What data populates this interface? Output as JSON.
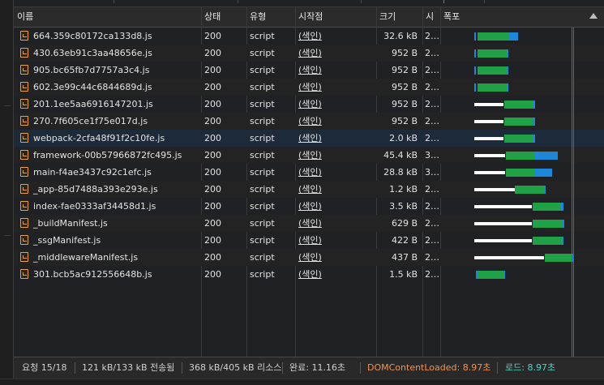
{
  "header": {
    "name": "이름",
    "status": "상태",
    "type": "유형",
    "initiator": "시작점",
    "size": "크기",
    "time": "시",
    "waterfall": "폭포"
  },
  "rows": [
    {
      "name": "664.359c80172ca133d8.js",
      "status": "200",
      "type": "script",
      "initiator": "(색인)",
      "size": "32.6 kB",
      "time": "2…"
    },
    {
      "name": "430.63eb91c3aa48656e.js",
      "status": "200",
      "type": "script",
      "initiator": "(색인)",
      "size": "952 B",
      "time": "2…"
    },
    {
      "name": "905.bc65fb7d7757a3c4.js",
      "status": "200",
      "type": "script",
      "initiator": "(색인)",
      "size": "952 B",
      "time": "2…"
    },
    {
      "name": "602.3e99c44c6844689d.js",
      "status": "200",
      "type": "script",
      "initiator": "(색인)",
      "size": "952 B",
      "time": "2…"
    },
    {
      "name": "201.1ee5aa6916147201.js",
      "status": "200",
      "type": "script",
      "initiator": "(색인)",
      "size": "952 B",
      "time": "2…"
    },
    {
      "name": "270.7f605ce1f75e017d.js",
      "status": "200",
      "type": "script",
      "initiator": "(색인)",
      "size": "952 B",
      "time": "2…"
    },
    {
      "name": "webpack-2cfa48f91f2c10fe.js",
      "status": "200",
      "type": "script",
      "initiator": "(색인)",
      "size": "2.0 kB",
      "time": "2…"
    },
    {
      "name": "framework-00b57966872fc495.js",
      "status": "200",
      "type": "script",
      "initiator": "(색인)",
      "size": "45.4 kB",
      "time": "3…"
    },
    {
      "name": "main-f4ae3437c92c1efc.js",
      "status": "200",
      "type": "script",
      "initiator": "(색인)",
      "size": "28.8 kB",
      "time": "3…"
    },
    {
      "name": "_app-85d7488a393e293e.js",
      "status": "200",
      "type": "script",
      "initiator": "(색인)",
      "size": "1.2 kB",
      "time": "2…"
    },
    {
      "name": "index-fae0333af34458d1.js",
      "status": "200",
      "type": "script",
      "initiator": "(색인)",
      "size": "3.5 kB",
      "time": "2…"
    },
    {
      "name": "_buildManifest.js",
      "status": "200",
      "type": "script",
      "initiator": "(색인)",
      "size": "629 B",
      "time": "2…"
    },
    {
      "name": "_ssgManifest.js",
      "status": "200",
      "type": "script",
      "initiator": "(색인)",
      "size": "422 B",
      "time": "2…"
    },
    {
      "name": "_middlewareManifest.js",
      "status": "200",
      "type": "script",
      "initiator": "(색인)",
      "size": "437 B",
      "time": "2…"
    },
    {
      "name": "301.bcb5ac912556648b.js",
      "status": "200",
      "type": "script",
      "initiator": "(색인)",
      "size": "1.5 kB",
      "time": "2…"
    }
  ],
  "footer": {
    "requests": "요청 15/18",
    "transferred": "121 kB/133 kB 전송됨",
    "resources": "368 kB/405 kB 리소스",
    "finish": "완료: 11.16초",
    "dom_content_loaded": "DOMContentLoaded: 8.97초",
    "load": "로드: 8.97초"
  },
  "colors": {
    "dom_content_loaded": "#f0934e",
    "load": "#4fd3c5",
    "waterfall_wait": "#21a146",
    "waterfall_download": "#1e88d8"
  }
}
